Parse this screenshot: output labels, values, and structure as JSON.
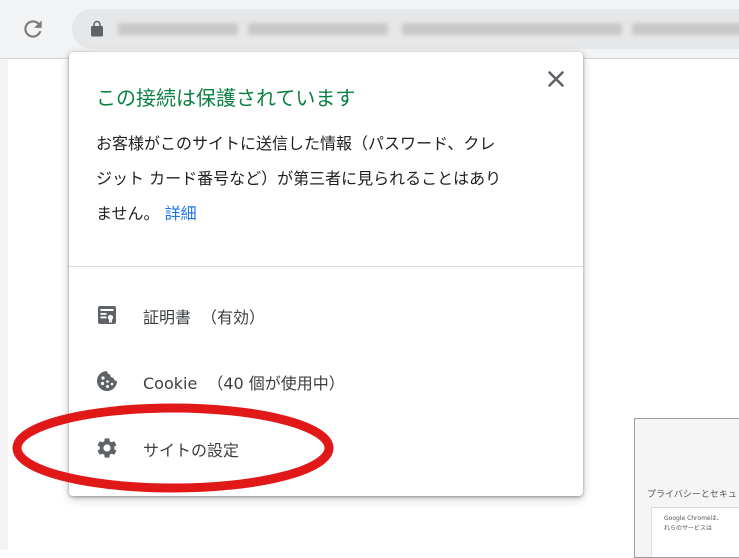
{
  "toolbar": {
    "reload_icon": "reload-icon",
    "lock_icon": "lock-icon"
  },
  "popup": {
    "title": "この接続は保護されています",
    "description_lines": [
      "お客様がこのサイトに送信した情報（パスワード、クレ",
      "ジット カード番号など）が第三者に見られることはあり",
      "ません。"
    ],
    "details_link": "詳細",
    "close_icon": "close-icon",
    "items": [
      {
        "icon": "certificate-icon",
        "label": "証明書",
        "detail": "（有効）"
      },
      {
        "icon": "cookie-icon",
        "label": "Cookie",
        "detail": "（40 個が使用中）"
      },
      {
        "icon": "gear-icon",
        "label": "サイトの設定",
        "detail": ""
      }
    ]
  },
  "background": {
    "heading": "プライバシーとセキュ",
    "text_lines": [
      "Google Chromeは、",
      "れらのサービスは"
    ]
  },
  "colors": {
    "title_green": "#0b8043",
    "link_blue": "#1a73e8",
    "annotation_red": "#e01818"
  }
}
